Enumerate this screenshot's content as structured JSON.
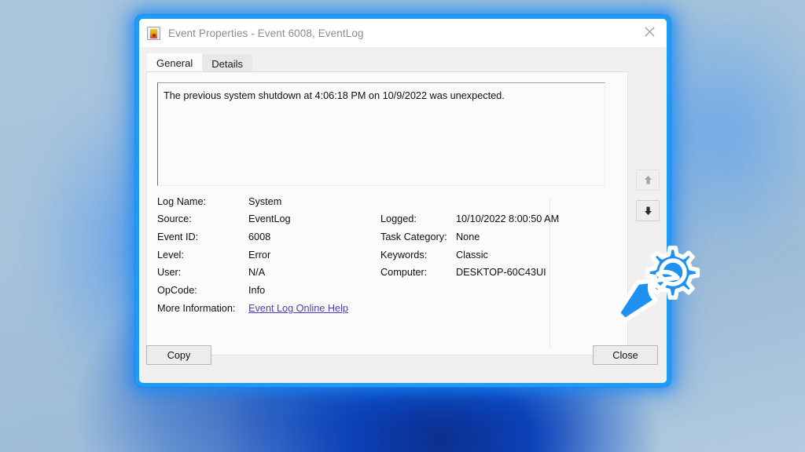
{
  "window": {
    "title": "Event Properties - Event 6008, EventLog",
    "icon": "event-properties-icon",
    "close_label": "✕"
  },
  "tabs": [
    {
      "label": "General",
      "active": true
    },
    {
      "label": "Details",
      "active": false
    }
  ],
  "description": {
    "text": "The previous system shutdown at 4:06:18 PM on 10/9/2022 was unexpected."
  },
  "fields": {
    "left": [
      {
        "label": "Log Name:",
        "value": "System"
      },
      {
        "label": "Source:",
        "value": "EventLog"
      },
      {
        "label": "Event ID:",
        "value": "6008"
      },
      {
        "label": "Level:",
        "value": "Error"
      },
      {
        "label": "User:",
        "value": "N/A"
      },
      {
        "label": "OpCode:",
        "value": "Info"
      }
    ],
    "right": [
      {
        "label": "Logged:",
        "value": "10/10/2022 8:00:50 AM"
      },
      {
        "label": "Task Category:",
        "value": "None"
      },
      {
        "label": "Keywords:",
        "value": "Classic"
      },
      {
        "label": "Computer:",
        "value": "DESKTOP-60C43UI"
      }
    ],
    "more_information": {
      "label": "More Information:",
      "link_text": "Event Log Online Help"
    }
  },
  "side_buttons": [
    {
      "name": "previous-event-button",
      "icon": "arrow-up-icon",
      "enabled": false
    },
    {
      "name": "next-event-button",
      "icon": "arrow-down-icon",
      "enabled": true
    }
  ],
  "footer": {
    "copy_label": "Copy",
    "close_label": "Close"
  },
  "colors": {
    "dialog_glow": "#1e9bf5",
    "link": "#4b3fbd",
    "desktop": "#a9c6de",
    "gear_overlay": "#1e90f0"
  }
}
